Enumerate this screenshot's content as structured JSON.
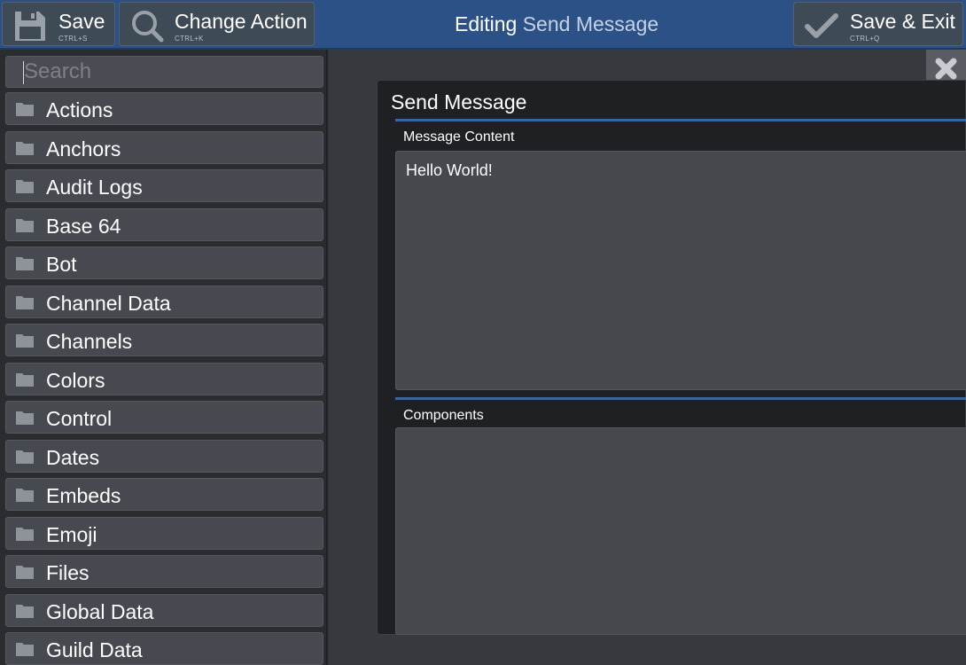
{
  "toolbar": {
    "save": {
      "label": "Save",
      "shortcut": "CTRL+S",
      "icon": "floppy-disk-icon"
    },
    "change_action": {
      "label": "Change Action",
      "shortcut": "CTRL+K",
      "icon": "search-icon"
    },
    "save_exit": {
      "label": "Save & Exit",
      "shortcut": "CTRL+Q",
      "icon": "checkmark-icon"
    }
  },
  "header": {
    "prefix": "Editing",
    "action_name": "Send Message"
  },
  "sidebar": {
    "search_placeholder": "Search",
    "categories": [
      "Actions",
      "Anchors",
      "Audit Logs",
      "Base 64",
      "Bot",
      "Channel Data",
      "Channels",
      "Colors",
      "Control",
      "Dates",
      "Embeds",
      "Emoji",
      "Files",
      "Global Data",
      "Guild Data"
    ]
  },
  "editor": {
    "title": "Send Message",
    "message_content": {
      "label": "Message Content",
      "value": "Hello World!"
    },
    "components": {
      "label": "Components",
      "value": ""
    }
  },
  "colors": {
    "topbar": "#2c5187",
    "accent": "#3a65a0",
    "panel": "#1e2024"
  }
}
